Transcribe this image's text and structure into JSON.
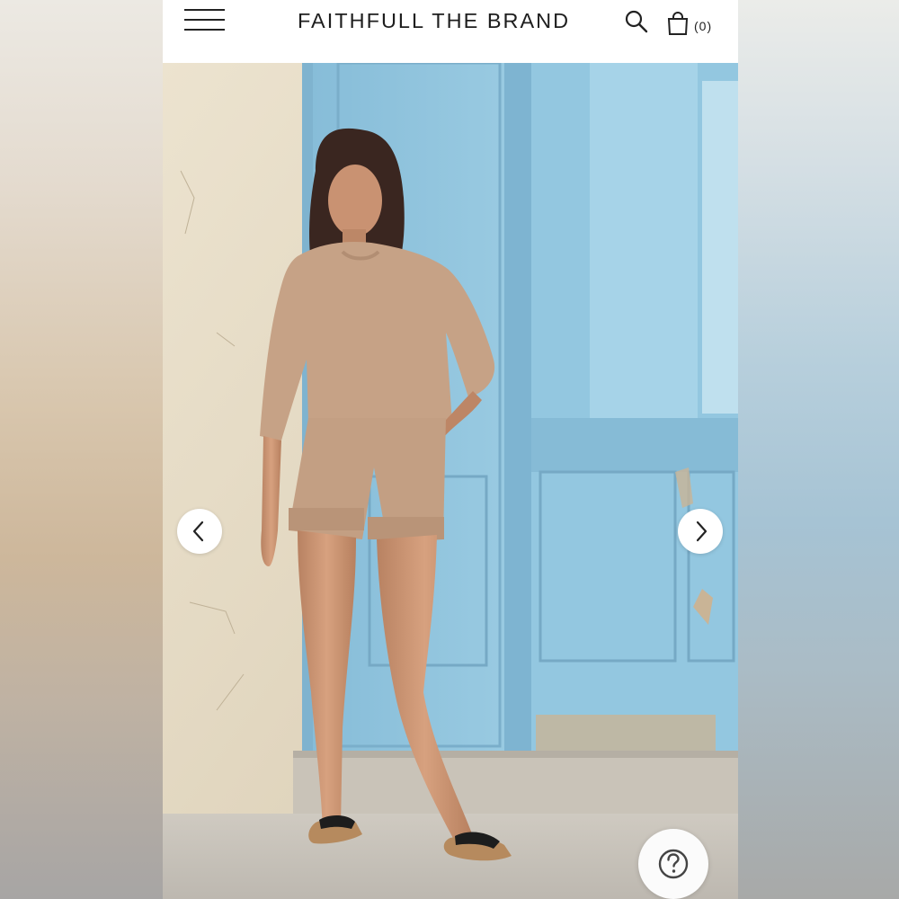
{
  "header": {
    "brand": "FAITHFULL THE BRAND",
    "cart_count": "(0)",
    "icons": {
      "menu": "hamburger-menu-icon",
      "search": "search-icon",
      "cart": "shopping-bag-icon"
    }
  },
  "gallery": {
    "image_alt": "Model wearing knit sweater and knit shorts in front of blue door",
    "prev_icon": "chevron-left-icon",
    "next_icon": "chevron-right-icon"
  },
  "help": {
    "icon": "question-mark-icon"
  },
  "colors": {
    "background": "#ffffff",
    "text": "#1e1e1e",
    "door_blue": "#8fc3dc",
    "wall": "#e6dcc6",
    "knit": "#c8a689"
  }
}
